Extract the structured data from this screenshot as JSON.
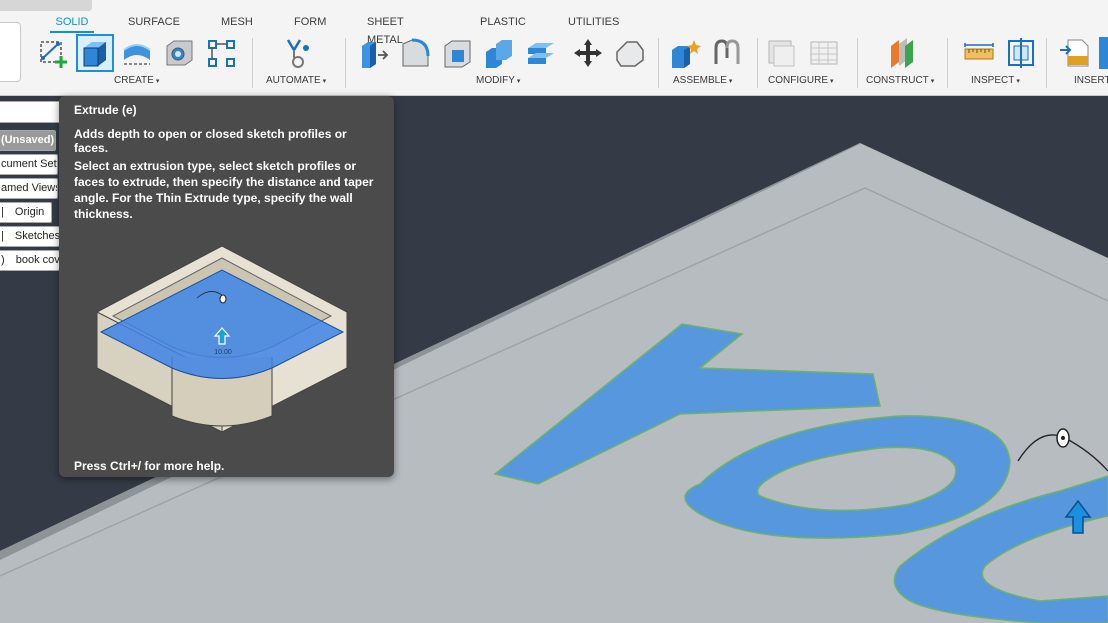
{
  "tabs": [
    "SOLID",
    "SURFACE",
    "MESH",
    "FORM",
    "SHEET METAL",
    "PLASTIC",
    "UTILITIES"
  ],
  "groups": {
    "create": "CREATE",
    "automate": "AUTOMATE",
    "modify": "MODIFY",
    "assemble": "ASSEMBLE",
    "configure": "CONFIGURE",
    "construct": "CONSTRUCT",
    "inspect": "INSPECT",
    "insert": "INSERT"
  },
  "caret": "▾",
  "browser": {
    "items": [
      "(Unsaved)",
      "cument Sett",
      "amed Views",
      "Origin",
      "Sketches",
      "book cov"
    ],
    "prefixes": [
      "",
      "",
      "",
      "|",
      "|",
      ")"
    ]
  },
  "tooltip": {
    "title": "Extrude (e)",
    "description": "Adds depth to open or closed sketch profiles or faces.",
    "details": "Select an extrusion type, select sketch profiles or faces to extrude, then specify the distance and taper angle. For the Thin Extrude type, specify the wall thickness.",
    "image_dimension": "10.00",
    "footer": "Press Ctrl+/ for more help."
  },
  "viewport": {
    "sketch_text": "YOU",
    "colors": {
      "background": "#343b46",
      "plate_top": "#b7bcc0",
      "profile": "#5797dd",
      "accent": "#0696d7"
    }
  },
  "icons": [
    "new-sketch-icon",
    "extrude-icon",
    "revolve-icon",
    "hole-icon",
    "pattern-icon",
    "automate-icon",
    "press-pull-icon",
    "fillet-icon",
    "chamfer-icon",
    "shell-icon",
    "combine-icon",
    "move-icon",
    "split-icon",
    "new-component-icon",
    "joint-icon",
    "parameters-icon",
    "configure-table-icon",
    "offset-plane-icon",
    "measure-icon",
    "section-analysis-icon",
    "insert-svg-icon"
  ]
}
